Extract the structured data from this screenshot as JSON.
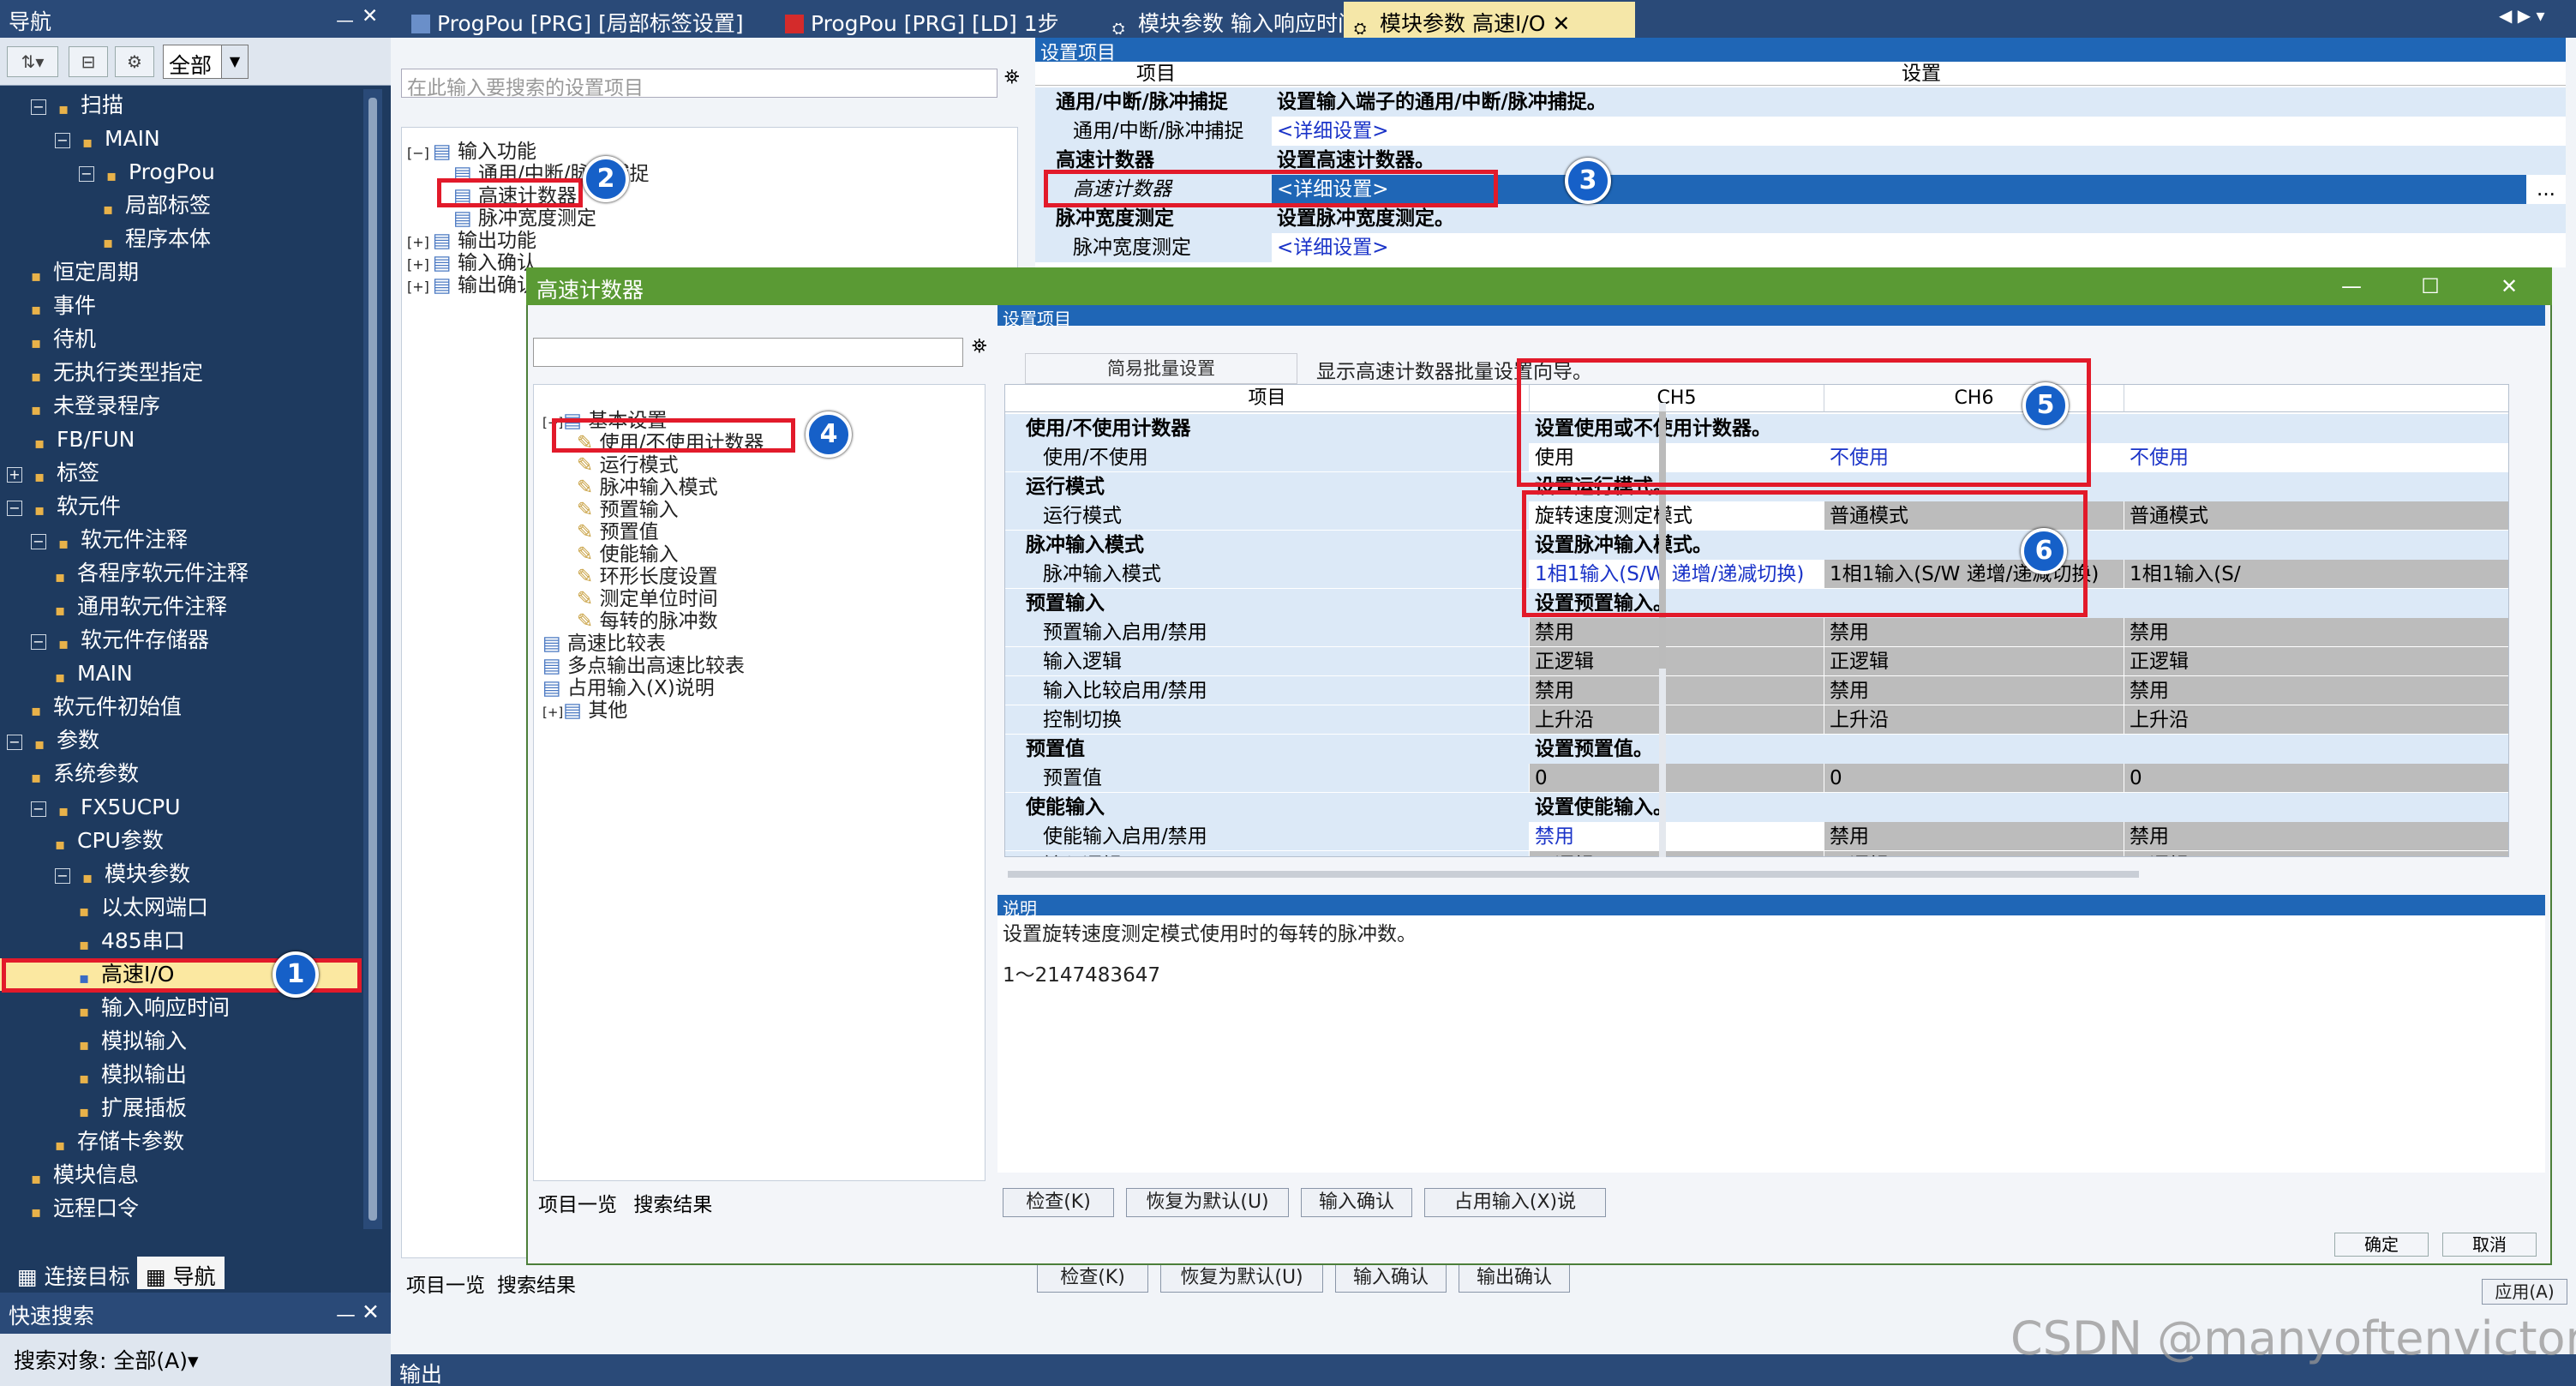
{
  "nav": {
    "title": "导航",
    "pin": "ᅳ",
    "close": "✕",
    "filter": "全部",
    "tree": [
      {
        "label": "扫描",
        "depth": 1,
        "exp": "−"
      },
      {
        "label": "MAIN",
        "depth": 2,
        "exp": "−"
      },
      {
        "label": "ProgPou",
        "depth": 3,
        "exp": "−"
      },
      {
        "label": "局部标签",
        "depth": 4,
        "exp": ""
      },
      {
        "label": "程序本体",
        "depth": 4,
        "exp": ""
      },
      {
        "label": "恒定周期",
        "depth": 1,
        "exp": ""
      },
      {
        "label": "事件",
        "depth": 1,
        "exp": ""
      },
      {
        "label": "待机",
        "depth": 1,
        "exp": ""
      },
      {
        "label": "无执行类型指定",
        "depth": 1,
        "exp": ""
      },
      {
        "label": "未登录程序",
        "depth": 1,
        "exp": ""
      },
      {
        "label": "FB/FUN",
        "depth": 0,
        "exp": ""
      },
      {
        "label": "标签",
        "depth": 0,
        "exp": "+"
      },
      {
        "label": "软元件",
        "depth": 0,
        "exp": "−"
      },
      {
        "label": "软元件注释",
        "depth": 1,
        "exp": "−"
      },
      {
        "label": "各程序软元件注释",
        "depth": 2,
        "exp": ""
      },
      {
        "label": "通用软元件注释",
        "depth": 2,
        "exp": ""
      },
      {
        "label": "软元件存储器",
        "depth": 1,
        "exp": "−"
      },
      {
        "label": "MAIN",
        "depth": 2,
        "exp": ""
      },
      {
        "label": "软元件初始值",
        "depth": 1,
        "exp": ""
      },
      {
        "label": "参数",
        "depth": 0,
        "exp": "−"
      },
      {
        "label": "系统参数",
        "depth": 1,
        "exp": ""
      },
      {
        "label": "FX5UCPU",
        "depth": 1,
        "exp": "−"
      },
      {
        "label": "CPU参数",
        "depth": 2,
        "exp": ""
      },
      {
        "label": "模块参数",
        "depth": 2,
        "exp": "−"
      },
      {
        "label": "以太网端口",
        "depth": 3,
        "exp": ""
      },
      {
        "label": "485串口",
        "depth": 3,
        "exp": ""
      },
      {
        "label": "高速I/O",
        "depth": 3,
        "exp": "",
        "selected": true
      },
      {
        "label": "输入响应时间",
        "depth": 3,
        "exp": ""
      },
      {
        "label": "模拟输入",
        "depth": 3,
        "exp": ""
      },
      {
        "label": "模拟输出",
        "depth": 3,
        "exp": ""
      },
      {
        "label": "扩展插板",
        "depth": 3,
        "exp": ""
      },
      {
        "label": "存储卡参数",
        "depth": 2,
        "exp": ""
      },
      {
        "label": "模块信息",
        "depth": 1,
        "exp": ""
      },
      {
        "label": "远程口令",
        "depth": 1,
        "exp": ""
      }
    ],
    "tab_connect": "连接目标",
    "tab_nav": "导航"
  },
  "quick": {
    "title": "快速搜索",
    "target": "搜索对象: 全部(A)▾"
  },
  "tabs": [
    {
      "label": "ProgPou [PRG] [局部标签设置]",
      "active": false
    },
    {
      "label": "ProgPou [PRG] [LD] 1步",
      "active": false
    },
    {
      "label": "模块参数 输入响应时间",
      "active": false
    },
    {
      "label": "模块参数 高速I/O",
      "active": true
    }
  ],
  "bg": {
    "search_placeholder": "在此输入要搜索的设置项目",
    "tree": [
      {
        "label": "输入功能",
        "exp": "−"
      },
      {
        "label": "通用/中断/脉冲捕捉",
        "exp": ""
      },
      {
        "label": "高速计数器",
        "exp": ""
      },
      {
        "label": "脉冲宽度测定",
        "exp": ""
      },
      {
        "label": "输出功能",
        "exp": "+"
      },
      {
        "label": "输入确认",
        "exp": "+"
      },
      {
        "label": "输出确认",
        "exp": "+"
      }
    ],
    "section_title": "设置项目",
    "col_item": "项目",
    "col_setting": "设置",
    "rows": [
      {
        "item": "通用/中断/脉冲捕捉",
        "setting": "设置输入端子的通用/中断/脉冲捕捉。",
        "type": "cat"
      },
      {
        "item": "通用/中断/脉冲捕捉",
        "setting": "<详细设置>",
        "type": "sub"
      },
      {
        "item": "高速计数器",
        "setting": "设置高速计数器。",
        "type": "cat"
      },
      {
        "item": "高速计数器",
        "setting": "<详细设置>",
        "type": "selected"
      },
      {
        "item": "脉冲宽度测定",
        "setting": "设置脉冲宽度测定。",
        "type": "cat"
      },
      {
        "item": "脉冲宽度测定",
        "setting": "<详细设置>",
        "type": "sub"
      }
    ],
    "ellipsis": "...",
    "tab_list": "项目一览",
    "tab_result": "搜索结果",
    "btn_check": "检查(K)",
    "btn_default": "恢复为默认(U)",
    "btn_input_confirm": "输入确认",
    "btn_output_confirm": "输出确认",
    "apply": "应用(A)",
    "output": "输出"
  },
  "dialog": {
    "title": "高速计数器",
    "minimize": "—",
    "maximize": "☐",
    "close": "✕",
    "tree": [
      {
        "label": "基本设置",
        "exp": "−",
        "depth": 1
      },
      {
        "label": "使用/不使用计数器",
        "exp": "",
        "depth": 2
      },
      {
        "label": "运行模式",
        "exp": "",
        "depth": 2
      },
      {
        "label": "脉冲输入模式",
        "exp": "",
        "depth": 2
      },
      {
        "label": "预置输入",
        "exp": "",
        "depth": 2
      },
      {
        "label": "预置值",
        "exp": "",
        "depth": 2
      },
      {
        "label": "使能输入",
        "exp": "",
        "depth": 2
      },
      {
        "label": "环形长度设置",
        "exp": "",
        "depth": 2
      },
      {
        "label": "测定单位时间",
        "exp": "",
        "depth": 2
      },
      {
        "label": "每转的脉冲数",
        "exp": "",
        "depth": 2
      },
      {
        "label": "高速比较表",
        "exp": "",
        "depth": 1
      },
      {
        "label": "多点输出高速比较表",
        "exp": "",
        "depth": 1
      },
      {
        "label": "占用输入(X)说明",
        "exp": "",
        "depth": 1
      },
      {
        "label": "其他",
        "exp": "+",
        "depth": 1
      }
    ],
    "tab_list": "项目一览",
    "tab_result": "搜索结果",
    "section_title": "设置项目",
    "wizard_btn": "简易批量设置",
    "wizard_desc": "显示高速计数器批量设置向导。",
    "col_item": "项目",
    "col_ch5": "CH5",
    "col_ch6": "CH6",
    "rows": [
      {
        "item": "使用/不使用计数器",
        "ch5": "设置使用或不使用计数器。",
        "ch6": "",
        "ch7": "",
        "type": "cat"
      },
      {
        "item": "使用/不使用",
        "ch5": "使用",
        "ch6": "不使用",
        "ch7": "不使用",
        "type": "sub",
        "style": "white",
        "blue6": true
      },
      {
        "item": "运行模式",
        "ch5": "设置运行模式。",
        "ch6": "",
        "ch7": "",
        "type": "cat"
      },
      {
        "item": "运行模式",
        "ch5": "旋转速度测定模式",
        "ch6": "普通模式",
        "ch7": "普通模式",
        "type": "sub",
        "style": "white5"
      },
      {
        "item": "脉冲输入模式",
        "ch5": "设置脉冲输入模式。",
        "ch6": "",
        "ch7": "",
        "type": "cat"
      },
      {
        "item": "脉冲输入模式",
        "ch5": "1相1输入(S/W 递增/递减切换)",
        "ch6": "1相1输入(S/W 递增/递减切换)",
        "ch7": "1相1输入(S/",
        "type": "sub",
        "style": "white5",
        "blue5": true
      },
      {
        "item": "预置输入",
        "ch5": "设置预置输入。",
        "ch6": "",
        "ch7": "",
        "type": "cat"
      },
      {
        "item": "预置输入启用/禁用",
        "ch5": "禁用",
        "ch6": "禁用",
        "ch7": "禁用",
        "type": "sub",
        "style": "gray"
      },
      {
        "item": "输入逻辑",
        "ch5": "正逻辑",
        "ch6": "正逻辑",
        "ch7": "正逻辑",
        "type": "sub",
        "style": "gray"
      },
      {
        "item": "输入比较启用/禁用",
        "ch5": "禁用",
        "ch6": "禁用",
        "ch7": "禁用",
        "type": "sub",
        "style": "gray"
      },
      {
        "item": "控制切换",
        "ch5": "上升沿",
        "ch6": "上升沿",
        "ch7": "上升沿",
        "type": "sub",
        "style": "gray"
      },
      {
        "item": "预置值",
        "ch5": "设置预置值。",
        "ch6": "",
        "ch7": "",
        "type": "cat"
      },
      {
        "item": "预置值",
        "ch5": "0",
        "ch6": "0",
        "ch7": "0",
        "type": "sub",
        "style": "gray"
      },
      {
        "item": "使能输入",
        "ch5": "设置使能输入。",
        "ch6": "",
        "ch7": "",
        "type": "cat"
      },
      {
        "item": "使能输入启用/禁用",
        "ch5": "禁用",
        "ch6": "禁用",
        "ch7": "禁用",
        "type": "sub",
        "style": "white5",
        "blue5": true
      },
      {
        "item": "输入逻辑",
        "ch5": "正逻辑",
        "ch6": "正逻辑",
        "ch7": "正逻辑",
        "type": "sub",
        "style": "gray"
      }
    ],
    "desc_title": "说明",
    "desc_text": "设置旋转速度测定模式使用时的每转的脉冲数。",
    "desc_range": "1～2147483647",
    "btn_check": "检查(K)",
    "btn_default": "恢复为默认(U)",
    "btn_input_confirm": "输入确认",
    "btn_occupy": "占用输入(X)说",
    "btn_ok": "确定",
    "btn_cancel": "取消"
  },
  "annotations": [
    "1",
    "2",
    "3",
    "4",
    "5",
    "6"
  ],
  "watermark": "CSDN @manyoftenvictory",
  "colors": {
    "accent": "#1f66b6",
    "highlight": "#e21a2a",
    "badge": "#1660c8",
    "dialog_title": "#5a9a34"
  }
}
